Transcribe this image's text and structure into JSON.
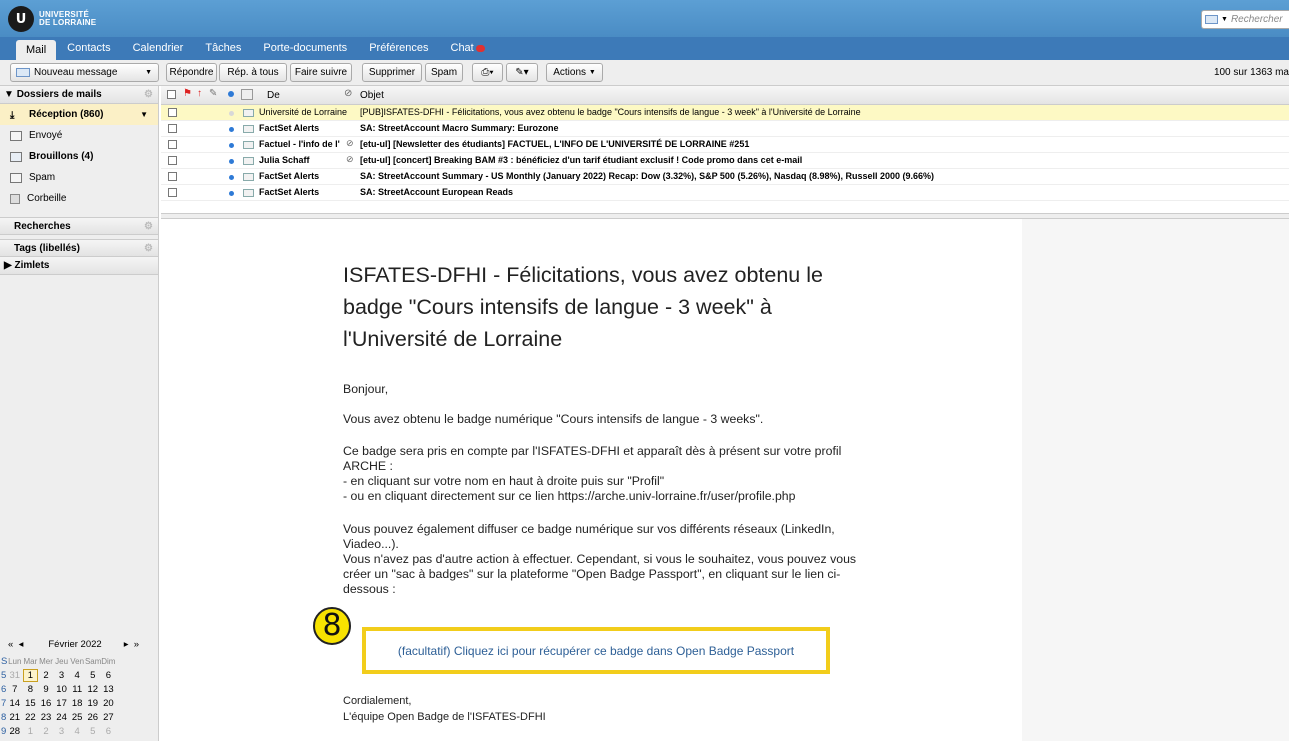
{
  "header": {
    "logo_mark": "U",
    "logo_line1": "UNIVERSITÉ",
    "logo_line2": "DE LORRAINE",
    "search_placeholder": "Rechercher"
  },
  "tabs": [
    {
      "label": "Mail",
      "active": true
    },
    {
      "label": "Contacts"
    },
    {
      "label": "Calendrier"
    },
    {
      "label": "Tâches"
    },
    {
      "label": "Porte-documents"
    },
    {
      "label": "Préférences"
    },
    {
      "label": "Chat"
    }
  ],
  "toolbar": {
    "new_message": "Nouveau message",
    "reply": "Répondre",
    "reply_all": "Rép. à tous",
    "forward": "Faire suivre",
    "delete": "Supprimer",
    "spam": "Spam",
    "actions": "Actions",
    "count": "100 sur 1363 ma"
  },
  "sidebar": {
    "mail_folders_header": "Dossiers de mails",
    "folders": [
      {
        "label": "Réception (860)",
        "selected": true
      },
      {
        "label": "Envoyé"
      },
      {
        "label": "Brouillons (4)",
        "bold": true
      },
      {
        "label": "Spam"
      },
      {
        "label": "Corbeille"
      }
    ],
    "searches_header": "Recherches",
    "tags_header": "Tags (libellés)",
    "zimlets_header": "Zimlets"
  },
  "calendar": {
    "month": "Février 2022",
    "week_label": "S",
    "days_of_week": [
      "Lun",
      "Mar",
      "Mer",
      "Jeu",
      "Ven",
      "Sam",
      "Dim"
    ],
    "weeks": [
      {
        "num": "5",
        "days": [
          "31",
          "1",
          "2",
          "3",
          "4",
          "5",
          "6"
        ]
      },
      {
        "num": "6",
        "days": [
          "7",
          "8",
          "9",
          "10",
          "11",
          "12",
          "13"
        ]
      },
      {
        "num": "7",
        "days": [
          "14",
          "15",
          "16",
          "17",
          "18",
          "19",
          "20"
        ]
      },
      {
        "num": "8",
        "days": [
          "21",
          "22",
          "23",
          "24",
          "25",
          "26",
          "27"
        ]
      },
      {
        "num": "9",
        "days": [
          "28",
          "1",
          "2",
          "3",
          "4",
          "5",
          "6"
        ]
      }
    ]
  },
  "list": {
    "col_from": "De",
    "col_subject": "Objet",
    "messages": [
      {
        "from": "Université de Lorraine",
        "subject": "[PUB]ISFATES-DFHI - Félicitations, vous avez obtenu le badge \"Cours intensifs de langue - 3 week\" à l'Université de Lorraine",
        "selected": true
      },
      {
        "from": "FactSet Alerts",
        "subject": "SA: StreetAccount Macro Summary: Eurozone",
        "unread": true
      },
      {
        "from": "Factuel - l'info de l'",
        "subject": "[etu-ul] [Newsletter des étudiants] FACTUEL, L'INFO DE L'UNIVERSITÉ DE LORRAINE #251",
        "unread": true,
        "attachment": true
      },
      {
        "from": "Julia Schaff",
        "subject": "[etu-ul] [concert] Breaking BAM #3 : bénéficiez d'un tarif étudiant exclusif ! Code promo dans cet e-mail",
        "unread": true,
        "attachment": true
      },
      {
        "from": "FactSet Alerts",
        "subject": "SA: StreetAccount Summary - US Monthly (January 2022) Recap: Dow (3.32%), S&P 500 (5.26%), Nasdaq (8.98%), Russell 2000 (9.66%)",
        "unread": true
      },
      {
        "from": "FactSet Alerts",
        "subject": "SA: StreetAccount European Reads",
        "unread": true
      }
    ]
  },
  "email": {
    "title": "ISFATES-DFHI - Félicitations, vous avez obtenu le badge \"Cours intensifs de langue - 3 week\" à l'Université de Lorraine",
    "greeting": "Bonjour,",
    "p1": "Vous avez obtenu le badge numérique \"Cours intensifs de langue - 3 weeks\".",
    "p2_line1": "Ce badge sera pris en compte par l'ISFATES-DFHI et apparaît dès à présent sur votre profil ARCHE :",
    "p2_line2": "- en cliquant sur votre nom en haut à droite puis sur \"Profil\"",
    "p2_line3": "- ou en cliquant directement sur ce lien https://arche.univ-lorraine.fr/user/profile.php",
    "p3": "Vous pouvez également diffuser ce badge numérique sur vos différents réseaux (LinkedIn, Viadeo...).",
    "p4": "Vous n'avez pas d'autre action à effectuer. Cependant, si vous le souhaitez, vous pouvez vous créer un \"sac à badges\" sur la plateforme \"Open Badge Passport\", en cliquant sur le lien ci-dessous :",
    "link": "(facultatif) Cliquez ici pour récupérer ce badge dans Open Badge Passport",
    "closing": "Cordialement,",
    "signature": "L'équipe Open Badge de l'ISFATES-DFHI"
  },
  "annotation": {
    "step": "8",
    "color": "#f2cd1b"
  }
}
